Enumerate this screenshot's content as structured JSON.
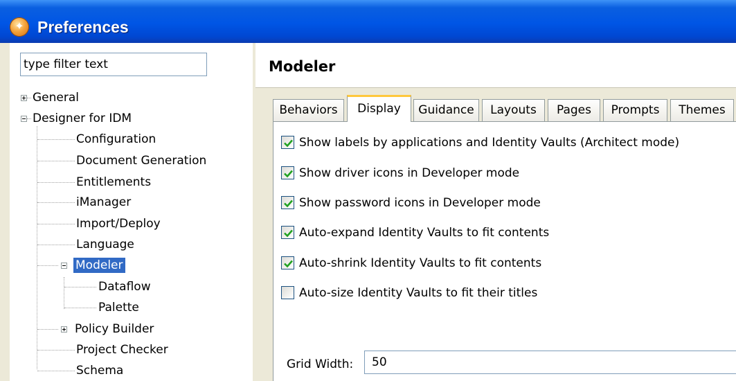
{
  "window": {
    "title": "Preferences"
  },
  "filter": {
    "placeholder": "type filter text",
    "value": "type filter text"
  },
  "tree": [
    {
      "label": "General",
      "expander": "plus"
    },
    {
      "label": "Designer for IDM",
      "expander": "minus"
    },
    {
      "label": "Configuration"
    },
    {
      "label": "Document Generation"
    },
    {
      "label": "Entitlements"
    },
    {
      "label": "iManager"
    },
    {
      "label": "Import/Deploy"
    },
    {
      "label": "Language"
    },
    {
      "label": "Modeler",
      "expander": "minus",
      "selected": true
    },
    {
      "label": "Dataflow"
    },
    {
      "label": "Palette"
    },
    {
      "label": "Policy Builder",
      "expander": "plus"
    },
    {
      "label": "Project Checker"
    },
    {
      "label": "Schema"
    }
  ],
  "page": {
    "title": "Modeler"
  },
  "tabs": [
    {
      "label": "Behaviors"
    },
    {
      "label": "Display",
      "active": true
    },
    {
      "label": "Guidance"
    },
    {
      "label": "Layouts"
    },
    {
      "label": "Pages"
    },
    {
      "label": "Prompts"
    },
    {
      "label": "Themes"
    }
  ],
  "options": [
    {
      "label": "Show labels by applications and Identity Vaults (Architect mode)",
      "checked": true
    },
    {
      "label": "Show driver icons in Developer mode",
      "checked": true
    },
    {
      "label": "Show password icons in Developer mode",
      "checked": true
    },
    {
      "label": "Auto-expand Identity Vaults to fit contents",
      "checked": true
    },
    {
      "label": "Auto-shrink Identity Vaults to fit contents",
      "checked": true
    },
    {
      "label": "Auto-size Identity Vaults to fit their titles",
      "checked": false
    }
  ],
  "grid": {
    "label": "Grid Width:",
    "value": "50"
  },
  "colors": {
    "titlebar": "#0055E5",
    "selection": "#316AC5",
    "active_tab_accent": "#FFC83C",
    "check": "#21A121"
  }
}
